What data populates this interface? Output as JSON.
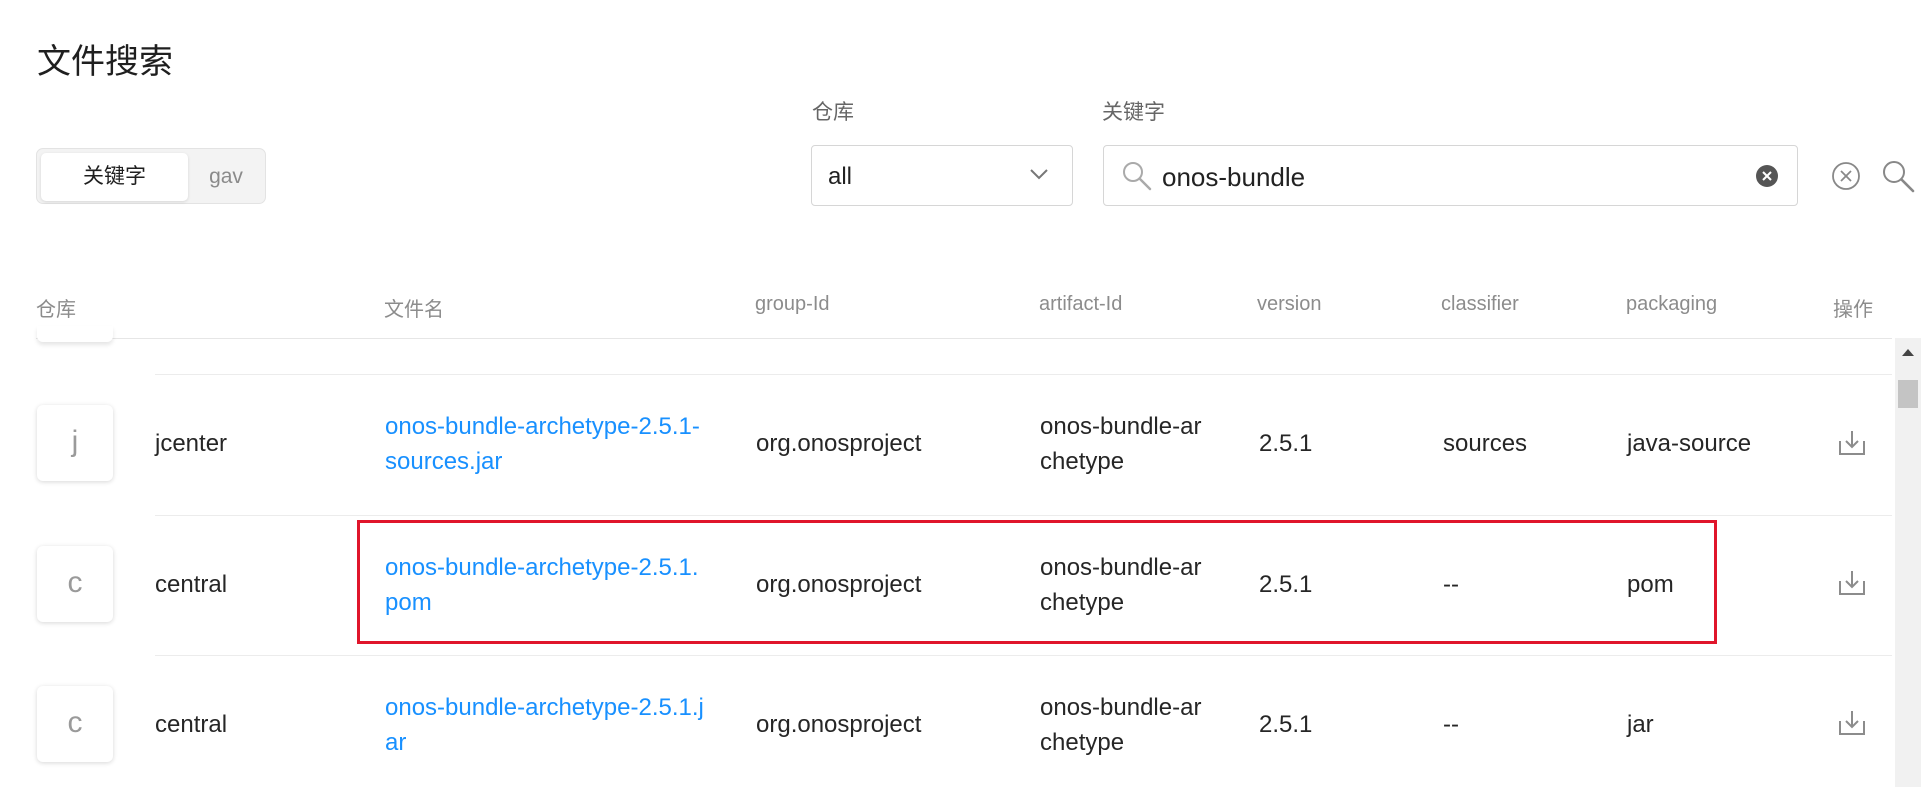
{
  "page": {
    "title": "文件搜索"
  },
  "mode_toggle": {
    "keyword_label": "关键字",
    "gav_label": "gav"
  },
  "repo_filter": {
    "label": "仓库",
    "selected": "all"
  },
  "keyword_filter": {
    "label": "关键字",
    "value": "onos-bundle"
  },
  "table": {
    "headers": {
      "repo": "仓库",
      "filename": "文件名",
      "group_id": "group-Id",
      "artifact_id": "artifact-Id",
      "version": "version",
      "classifier": "classifier",
      "packaging": "packaging",
      "actions": "操作"
    },
    "rows": [
      {
        "avatar": "j",
        "repo": "jcenter",
        "filename_line1": "onos-bundle-archetype-2.5.1-",
        "filename_line2": "sources.jar",
        "group_id": "org.onosproject",
        "artifact_line1": "onos-bundle-ar",
        "artifact_line2": "chetype",
        "version": "2.5.1",
        "classifier": "sources",
        "packaging": "java-source"
      },
      {
        "avatar": "c",
        "repo": "central",
        "filename_line1": "onos-bundle-archetype-2.5.1.",
        "filename_line2": "pom",
        "group_id": "org.onosproject",
        "artifact_line1": "onos-bundle-ar",
        "artifact_line2": "chetype",
        "version": "2.5.1",
        "classifier": "--",
        "packaging": "pom"
      },
      {
        "avatar": "c",
        "repo": "central",
        "filename_line1": "onos-bundle-archetype-2.5.1.j",
        "filename_line2": "ar",
        "group_id": "org.onosproject",
        "artifact_line1": "onos-bundle-ar",
        "artifact_line2": "chetype",
        "version": "2.5.1",
        "classifier": "--",
        "packaging": "jar"
      }
    ]
  },
  "colors": {
    "link": "#1890ff",
    "highlight": "#e0162b",
    "header_text": "#8c8c8c"
  }
}
